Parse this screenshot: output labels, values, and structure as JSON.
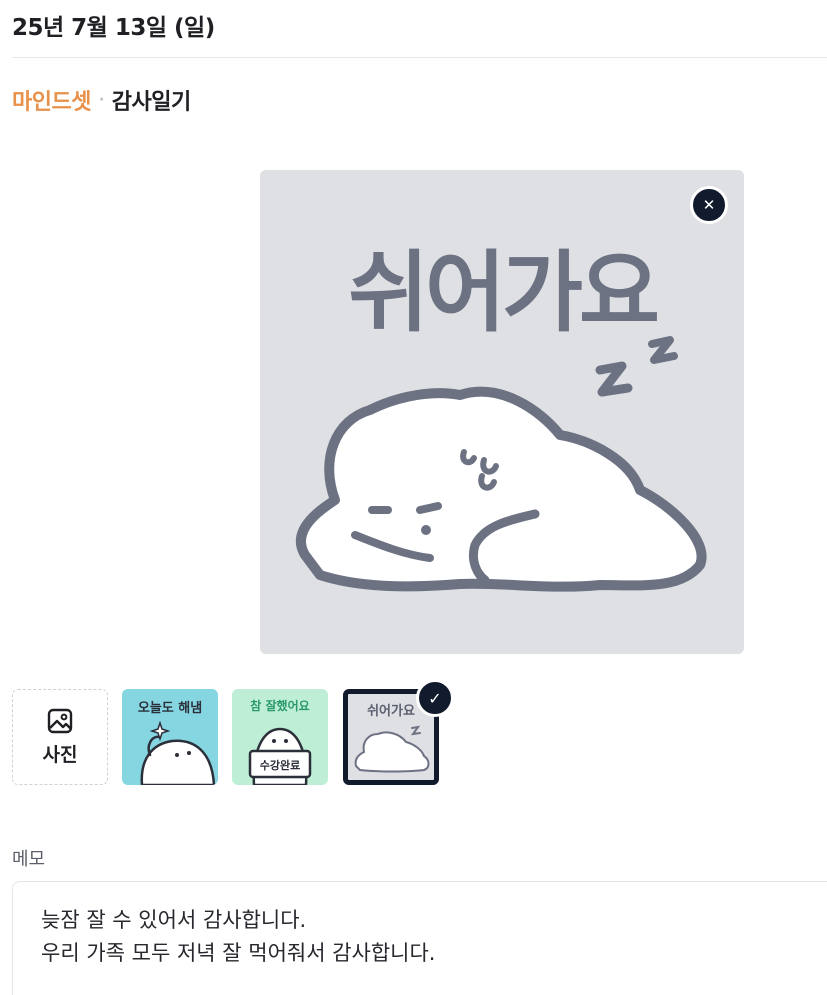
{
  "header": {
    "date": "25년 7월 13일 (일)"
  },
  "breadcrumb": {
    "category": "마인드셋",
    "separator": "·",
    "current": "감사일기"
  },
  "preview": {
    "sticker_text": "쉬어가요",
    "close_icon": "close-icon"
  },
  "stickers": {
    "photo_label": "사진",
    "photo_icon": "image-icon",
    "items": [
      {
        "text": "오늘도 해냄",
        "bg": "#86d6e2",
        "selected": false
      },
      {
        "text": "참 잘했어요",
        "bottom_text": "수강완료",
        "bg": "#bfeed6",
        "selected": false
      },
      {
        "text": "쉬어가요",
        "bg": "#dfe0e4",
        "selected": true
      }
    ]
  },
  "memo": {
    "label": "메모",
    "lines": [
      "늦잠 잘 수 있어서 감사합니다.",
      "우리 가족 모두 저녁 잘 먹어줘서 감사합니다."
    ]
  },
  "colors": {
    "accent": "#e8914a",
    "dark": "#121a2e",
    "sticker_gray": "#6d7283"
  }
}
